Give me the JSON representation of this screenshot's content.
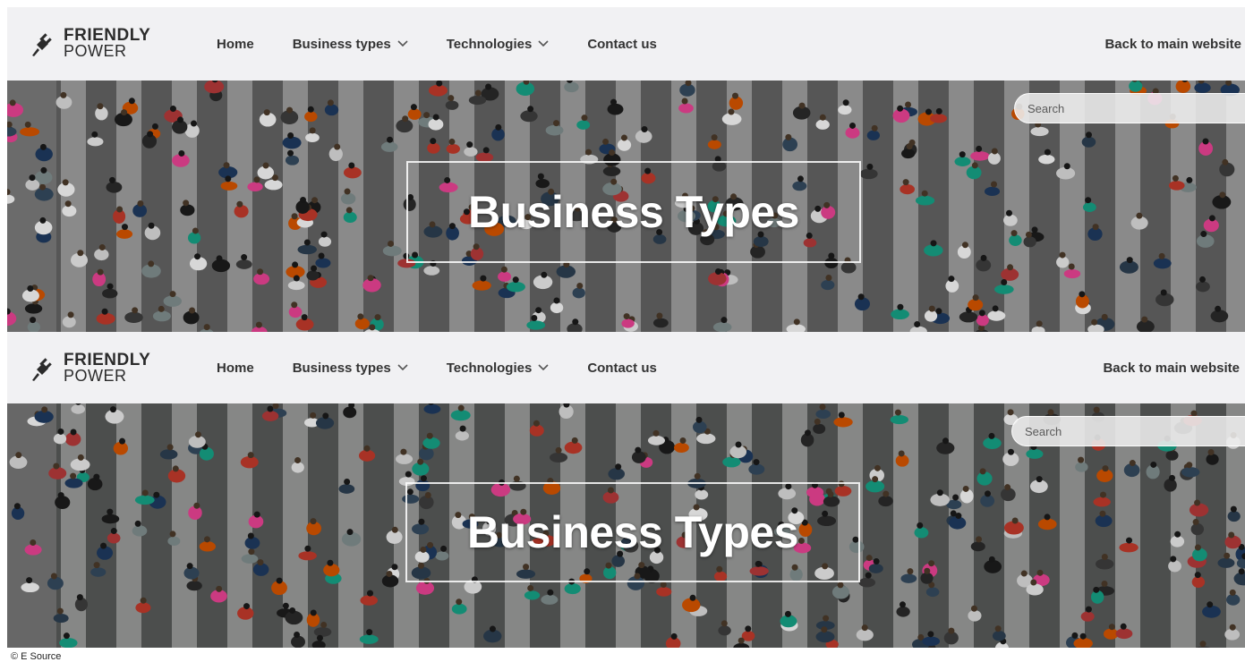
{
  "screenshots": [
    {
      "logo": {
        "line1": "FRIENDLY",
        "line2": "POWER",
        "icon": "plug-icon"
      },
      "nav": {
        "home": "Home",
        "business_types": "Business types",
        "technologies": "Technologies",
        "contact": "Contact us"
      },
      "back_link": "Back to main website",
      "search": {
        "placeholder": "Search"
      },
      "hero": {
        "title": "Business Types"
      }
    },
    {
      "logo": {
        "line1": "FRIENDLY",
        "line2": "POWER",
        "icon": "plug-icon"
      },
      "nav": {
        "home": "Home",
        "business_types": "Business types",
        "technologies": "Technologies",
        "contact": "Contact us"
      },
      "back_link": "Back to main website",
      "search": {
        "placeholder": "Search"
      },
      "hero": {
        "title": "Business Types"
      }
    }
  ],
  "copyright": "© E Source",
  "colors": {
    "nav_bg": "#f1f1f3",
    "nav_text": "#333333",
    "hero_text": "#ffffff"
  }
}
